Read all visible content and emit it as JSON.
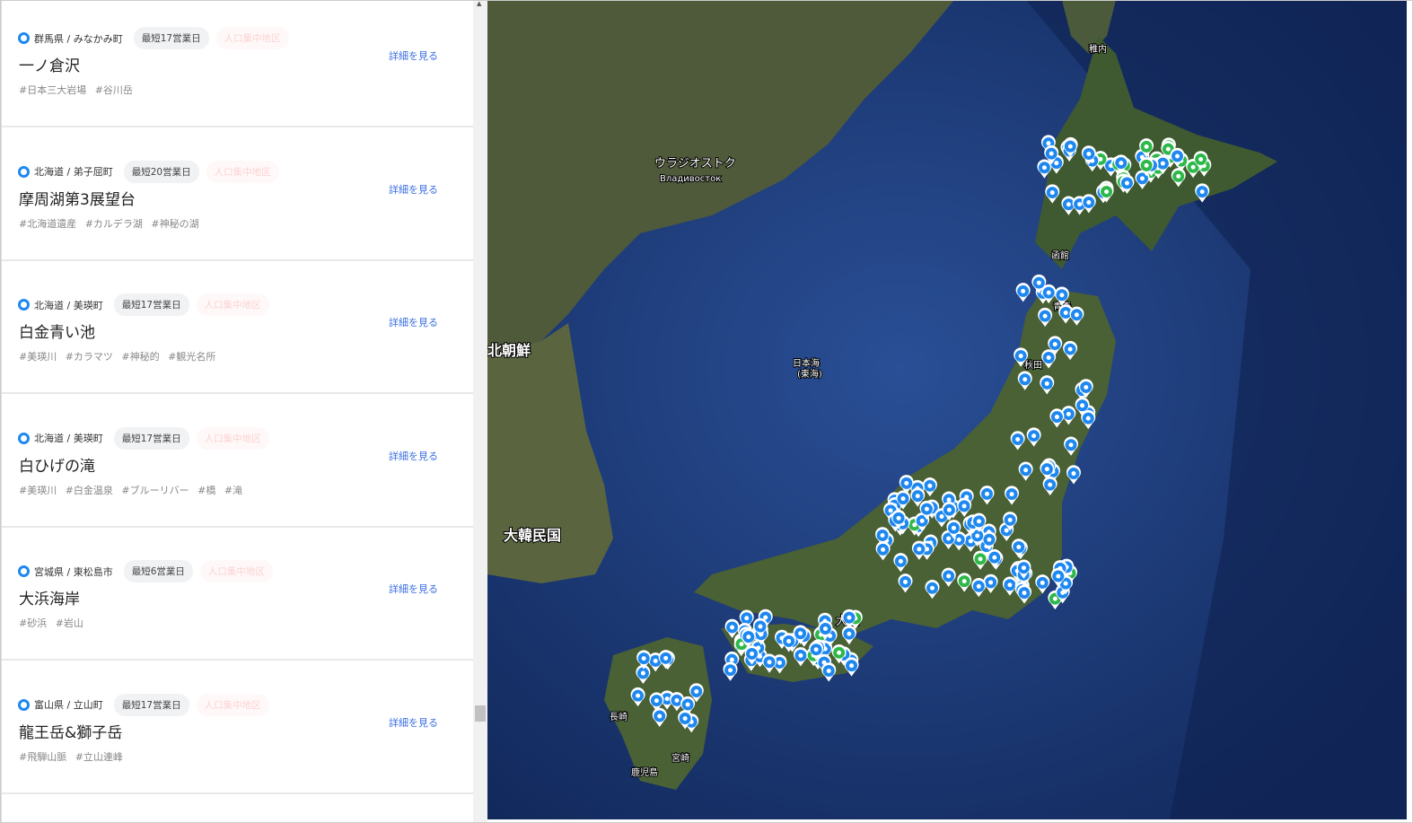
{
  "cards": [
    {
      "location": "群馬県 / みなかみ町",
      "lead": "最短17営業日",
      "zone": "人口集中地区",
      "title": "一ノ倉沢",
      "tags": "#日本三大岩場 #谷川岳",
      "detail": "詳細を見る"
    },
    {
      "location": "北海道 / 弟子屈町",
      "lead": "最短20営業日",
      "zone": "人口集中地区",
      "title": "摩周湖第3展望台",
      "tags": "#北海道遺産 #カルデラ湖 #神秘の湖",
      "detail": "詳細を見る"
    },
    {
      "location": "北海道 / 美瑛町",
      "lead": "最短17営業日",
      "zone": "人口集中地区",
      "title": "白金青い池",
      "tags": "#美瑛川 #カラマツ #神秘的 #観光名所",
      "detail": "詳細を見る"
    },
    {
      "location": "北海道 / 美瑛町",
      "lead": "最短17営業日",
      "zone": "人口集中地区",
      "title": "白ひげの滝",
      "tags": "#美瑛川 #白金温泉 #ブルーリバー #橋 #滝",
      "detail": "詳細を見る"
    },
    {
      "location": "宮城県 / 東松島市",
      "lead": "最短6営業日",
      "zone": "人口集中地区",
      "title": "大浜海岸",
      "tags": "#砂浜 #岩山",
      "detail": "詳細を見る"
    },
    {
      "location": "富山県 / 立山町",
      "lead": "最短17営業日",
      "zone": "人口集中地区",
      "title": "龍王岳&獅子岳",
      "tags": "#飛騨山脈 #立山連峰",
      "detail": "詳細を見る"
    }
  ],
  "map": {
    "labels": {
      "sea": "日本海",
      "sea2": "(東海)",
      "korea": "大韓民国",
      "nk": "北朝鮮",
      "vlad": "ウラジオストク",
      "vlad_ru": "Владивосток",
      "osaka": "大阪",
      "hakodate": "函館",
      "aomori": "青森",
      "akita": "秋田",
      "kagoshima": "鹿児島",
      "miyazaki": "宮崎",
      "wakkanai": "稚内",
      "nagasaki": "長崎"
    },
    "marker_colors": {
      "blue": "#1e88f0",
      "green": "#2db84a"
    }
  }
}
